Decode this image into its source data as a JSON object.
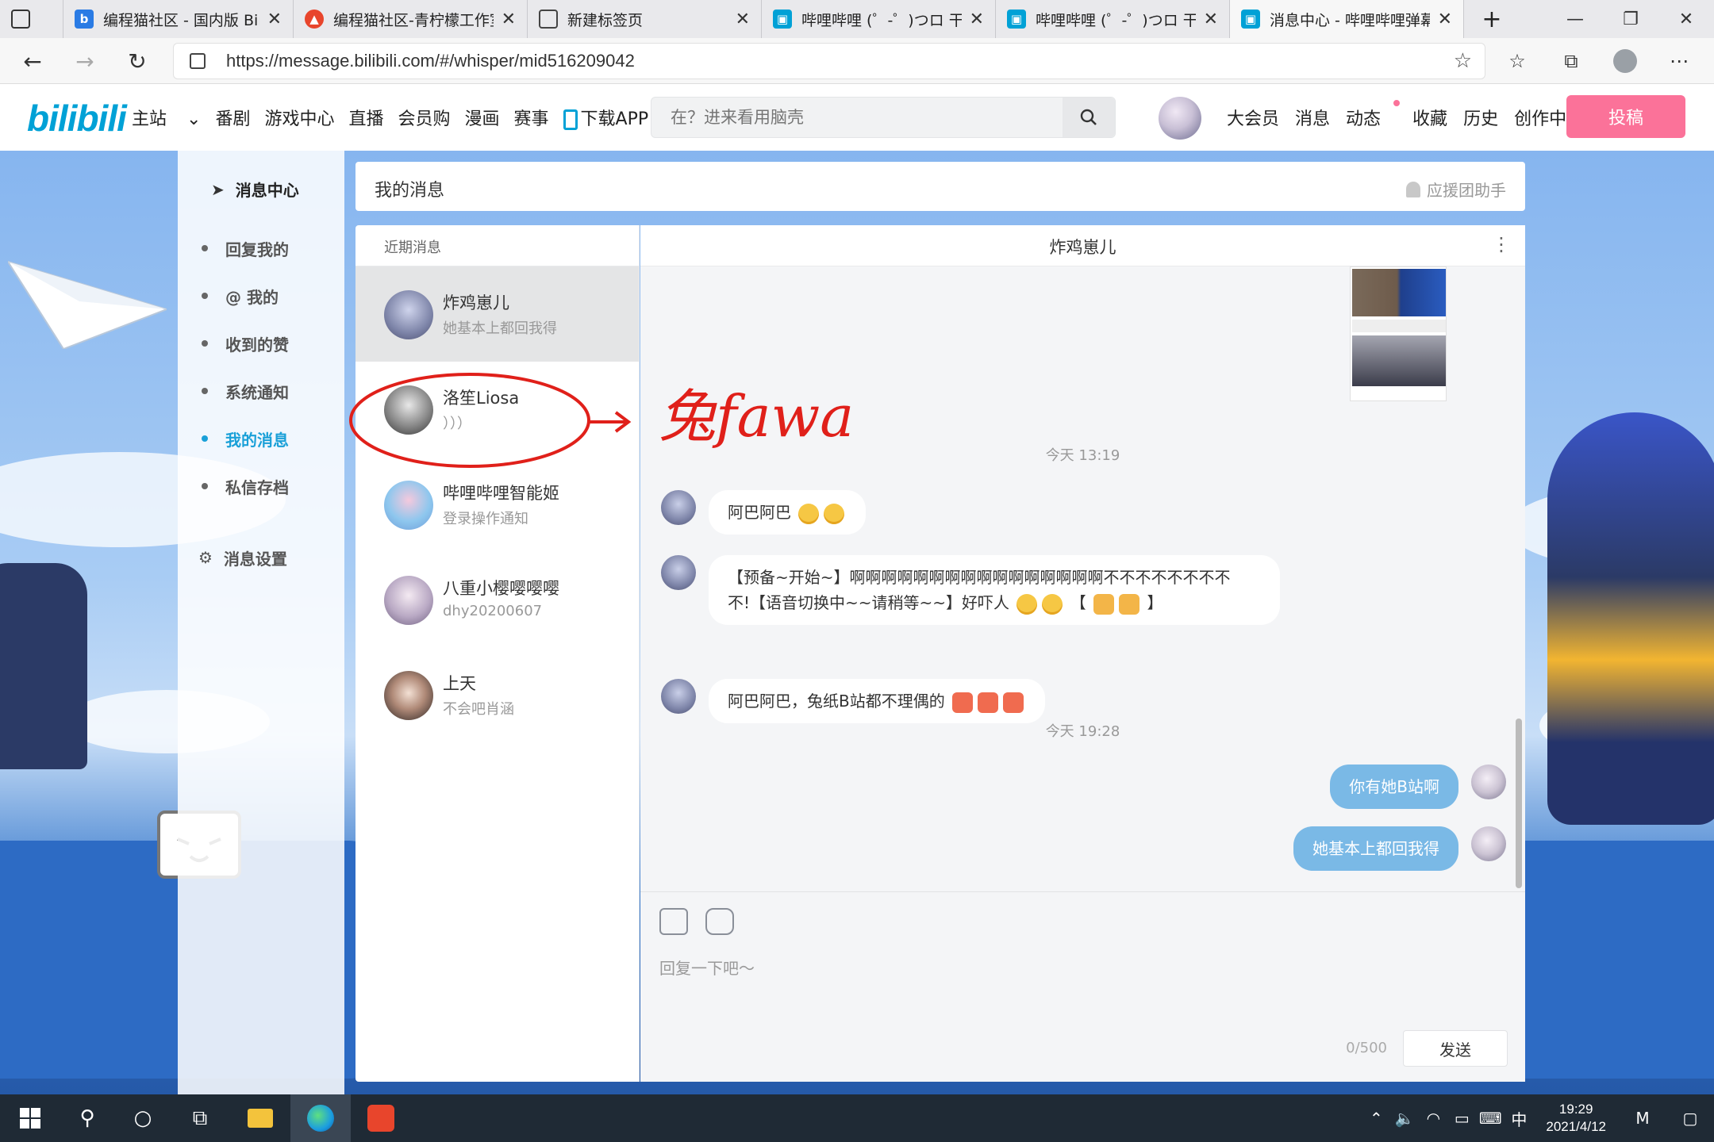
{
  "browser": {
    "tabs": [
      {
        "title": "编程猫社区 - 国内版 Bing",
        "icon": "bing-icon",
        "color": "#2a7be4"
      },
      {
        "title": "编程猫社区-青柠檬工作室",
        "icon": "codemao-icon",
        "color": "#e8452c"
      },
      {
        "title": "新建标签页",
        "icon": "newtab-icon",
        "color": "#555555"
      },
      {
        "title": "哔哩哔哩 (゜-゜)つロ 干杯~",
        "icon": "bilibili-tv-icon",
        "color": "#00a1d6"
      },
      {
        "title": "哔哩哔哩 (゜-゜)つロ 干杯~",
        "icon": "bilibili-tv-icon",
        "color": "#00a1d6"
      },
      {
        "title": "消息中心 - 哔哩哔哩弹幕视频网",
        "icon": "bilibili-tv-icon",
        "color": "#00a1d6"
      }
    ],
    "url": "https://message.bilibili.com/#/whisper/mid516209042"
  },
  "header": {
    "logo": "bilibili",
    "nav": [
      "主站",
      "番剧",
      "游戏中心",
      "直播",
      "会员购",
      "漫画",
      "赛事",
      "下载APP"
    ],
    "search_placeholder": "在？进来看用脑壳",
    "right_nav": [
      "大会员",
      "消息",
      "动态",
      "收藏",
      "历史",
      "创作中心"
    ],
    "post_label": "投稿",
    "brand_color": "#00a1d6",
    "accent_color": "#fb7299"
  },
  "sidebar": {
    "title": "消息中心",
    "items": [
      "回复我的",
      "@ 我的",
      "收到的赞",
      "系统通知",
      "我的消息",
      "私信存档"
    ],
    "active_index": 4,
    "settings_label": "消息设置"
  },
  "panel": {
    "title": "我的消息",
    "helper": "应援团助手"
  },
  "conversations": {
    "header": "近期消息",
    "items": [
      {
        "name": "炸鸡崽儿",
        "last": "她基本上都回我得"
      },
      {
        "name": "洛笙Liosa",
        "last": "）））"
      },
      {
        "name": "哔哩哔哩智能姬",
        "last": "登录操作通知"
      },
      {
        "name": "八重小樱嘤嘤嘤",
        "last": "dhy20200607"
      },
      {
        "name": "上天",
        "last": "不会吧肖涵"
      }
    ]
  },
  "chat": {
    "partner": "炸鸡崽儿",
    "time_1": "今天 13:19",
    "msg_1": "阿巴阿巴",
    "msg_2_a": "【预备~开始~】啊啊啊啊啊啊啊啊啊啊啊啊啊啊啊啊不不不不不不不不",
    "msg_2_b": "不!【语音切换中~~请稍等~~】好吓人",
    "msg_2_c": "【",
    "msg_2_d": "】",
    "msg_3": "阿巴阿巴，兔纸B站都不理偶的",
    "time_2": "今天 19:28",
    "my_msg_1": "你有她B站啊",
    "my_msg_2": "她基本上都回我得",
    "input_placeholder": "回复一下吧～",
    "counter": "0/500",
    "send_label": "发送"
  },
  "annotation": "兔fawa",
  "taskbar": {
    "time": "19:29",
    "date": "2021/4/12",
    "ime": "中"
  }
}
